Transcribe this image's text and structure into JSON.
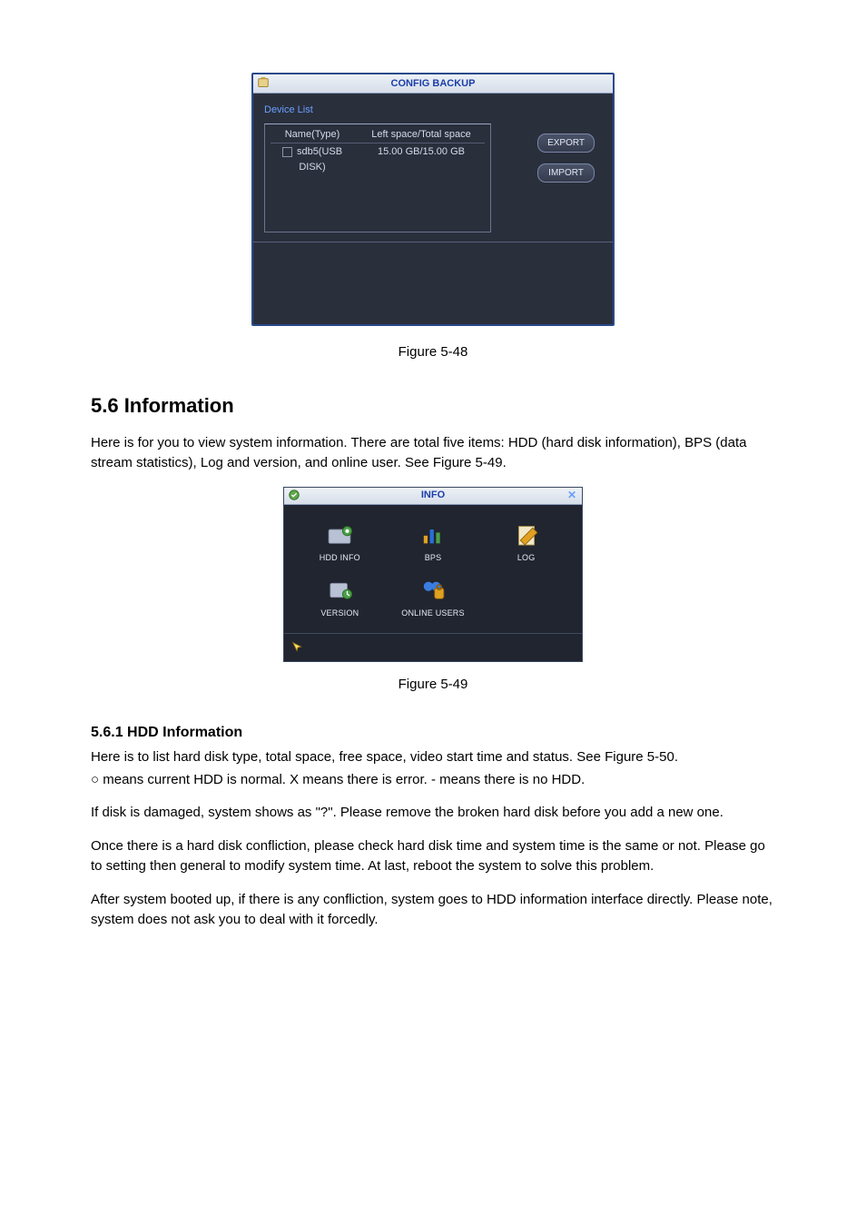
{
  "fig548": {
    "title": "CONFIG BACKUP",
    "device_list_label": "Device List",
    "columns": {
      "name": "Name(Type)",
      "space": "Left space/Total space"
    },
    "rows": [
      {
        "name": "sdb5(USB DISK)",
        "space": "15.00 GB/15.00 GB"
      }
    ],
    "export_btn": "EXPORT",
    "import_btn": "IMPORT",
    "caption": "Figure 5-48"
  },
  "sec56": {
    "heading": "5.6  Information",
    "intro": "Here is for you to view system information. There are total five items: HDD (hard disk information), BPS (data stream statistics), Log and version, and online user. See Figure 5-49."
  },
  "fig549": {
    "title": "INFO",
    "items": {
      "hdd": "HDD INFO",
      "bps": "BPS",
      "log": "LOG",
      "version": "VERSION",
      "online": "ONLINE USERS"
    },
    "caption": "Figure 5-49"
  },
  "sec561": {
    "heading": "5.6.1  HDD Information",
    "p1": "Here is to list hard disk type, total space, free space, video start time and status. See Figure 5-50.",
    "p2": "○ means current HDD is normal. X means there is error. - means there is no HDD.",
    "p3": "If disk is damaged, system shows as \"?\". Please remove the broken hard disk before you add a new one.",
    "p4": "Once there is a hard disk confliction, please check hard disk time and system time is the same or not. Please go to setting then general to modify system time.  At last, reboot the system to solve this problem.",
    "p5": "After system booted up, if there is any confliction, system goes to HDD information interface directly. Please note, system does not ask you to deal with it forcedly."
  }
}
